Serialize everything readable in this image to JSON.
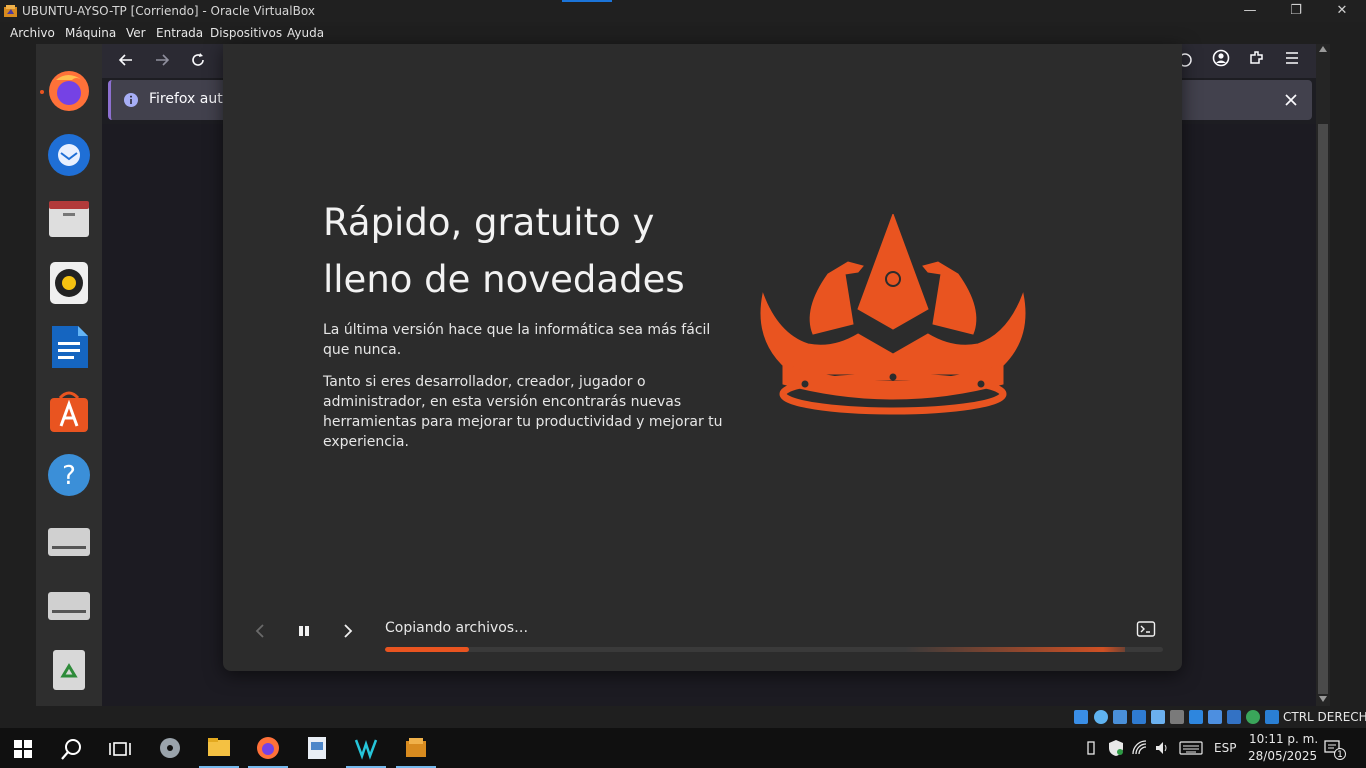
{
  "window": {
    "title": "UBUNTU-AYSO-TP [Corriendo] - Oracle VirtualBox",
    "controls": {
      "minimize": "—",
      "maximize": "❐",
      "close": "✕"
    }
  },
  "menubar": {
    "items": [
      "Archivo",
      "Máquina",
      "Ver",
      "Entrada",
      "Dispositivos",
      "Ayuda"
    ]
  },
  "firefox": {
    "notification": "Firefox auto"
  },
  "installer": {
    "headline_line1": "Rápido, gratuito y",
    "headline_line2": "lleno de novedades",
    "paragraph1": "La última versión hace que la informática sea más fácil que nunca.",
    "paragraph2": "Tanto si eres desarrollador, creador, jugador o administrador, en esta versión encontrarás nuevas herramientas para mejorar tu productividad y mejorar tu experiencia.",
    "status": "Copiando archivos…",
    "progress_fraction": 0.108,
    "accent_color": "#e95420"
  },
  "dock": {
    "icons": [
      "firefox-icon",
      "thunderbird-icon",
      "files-icon",
      "rhythmbox-icon",
      "writer-icon",
      "app-center-icon",
      "help-icon",
      "drive-icon",
      "drive-icon",
      "trash-icon"
    ]
  },
  "vbox_status": {
    "host_key": "CTRL DERECHA"
  },
  "taskbar": {
    "language": "ESP",
    "time": "10:11 p. m.",
    "date": "28/05/2025",
    "notification_count": "1"
  }
}
